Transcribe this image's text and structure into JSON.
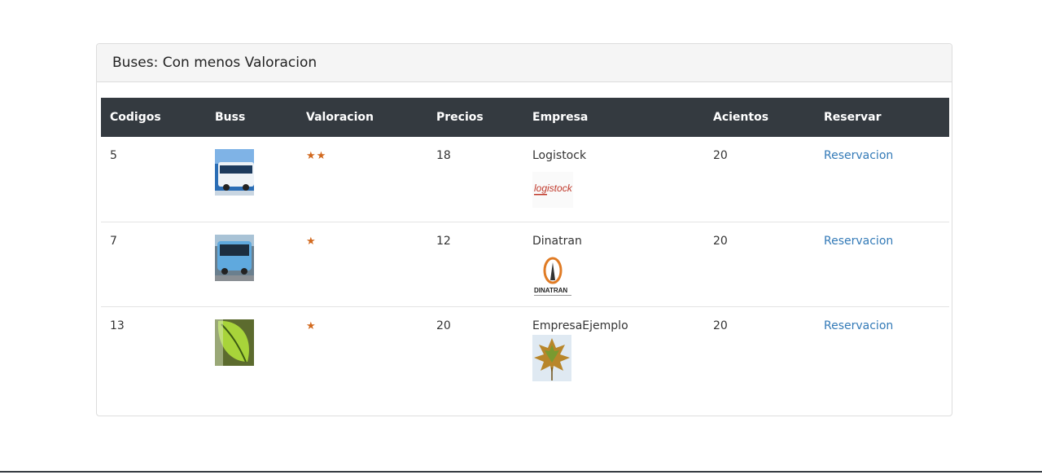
{
  "panel": {
    "title": "Buses: Con menos Valoracion"
  },
  "table": {
    "headers": [
      "Codigos",
      "Buss",
      "Valoracion",
      "Precios",
      "Empresa",
      "Acientos",
      "Reservar"
    ],
    "rows": [
      {
        "codigo": "5",
        "stars": "★★",
        "rating": 2,
        "precio": "18",
        "empresa": "Logistock",
        "logo_text": "logistock",
        "acientos": "20",
        "reservar": "Reservacion"
      },
      {
        "codigo": "7",
        "stars": "★",
        "rating": 1,
        "precio": "12",
        "empresa": "Dinatran",
        "logo_text": "DINATRAN",
        "acientos": "20",
        "reservar": "Reservacion"
      },
      {
        "codigo": "13",
        "stars": "★",
        "rating": 1,
        "precio": "20",
        "empresa": "EmpresaEjemplo",
        "logo_text": "",
        "acientos": "20",
        "reservar": "Reservacion"
      }
    ]
  },
  "colors": {
    "header_bg": "#343a40",
    "star": "#d2691e",
    "link": "#337ab7"
  }
}
